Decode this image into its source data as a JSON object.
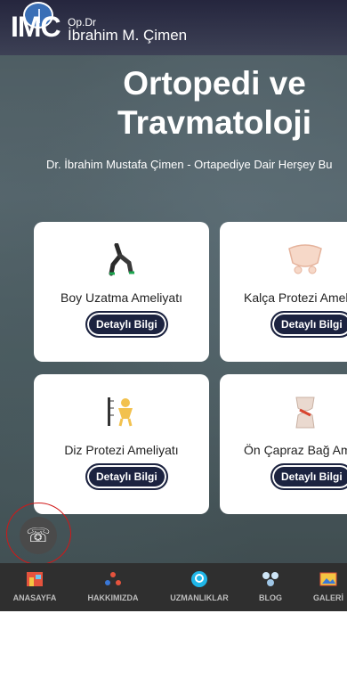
{
  "header": {
    "logo_mark": "IMC",
    "logo_prefix": "Op.Dr",
    "logo_name": "İbrahim M. Çimen"
  },
  "hero": {
    "title_line1": "Ortopedi ve",
    "title_line2": "Travmatoloji",
    "subtitle": "Dr. İbrahim Mustafa Çimen - Ortapediye Dair Herşey Bu"
  },
  "cards": [
    {
      "title": "Boy Uzatma Ameliyatı",
      "button": "Detaylı Bilgi",
      "icon": "leg-icon"
    },
    {
      "title": "Kalça Protezi Ameliyatı",
      "button": "Detaylı Bilgi",
      "icon": "hip-bone-icon"
    },
    {
      "title": "Diz Protezi Ameliyatı",
      "button": "Detaylı Bilgi",
      "icon": "height-measure-icon"
    },
    {
      "title": "Ön Çapraz Bağ Ameliyatı",
      "button": "Detaylı Bilgi",
      "icon": "knee-joint-icon"
    }
  ],
  "bottom_nav": [
    {
      "label": "ANASAYFA",
      "icon": "home-icon"
    },
    {
      "label": "HAKKIMIZDA",
      "icon": "team-icon"
    },
    {
      "label": "UZMANLIKLAR",
      "icon": "expertise-icon"
    },
    {
      "label": "BLOG",
      "icon": "blog-icon"
    },
    {
      "label": "GALERİ",
      "icon": "gallery-icon"
    }
  ],
  "colors": {
    "nav_bg": "#2f2f2f",
    "button_bg": "#1c2340",
    "call_ring": "#d01818"
  }
}
